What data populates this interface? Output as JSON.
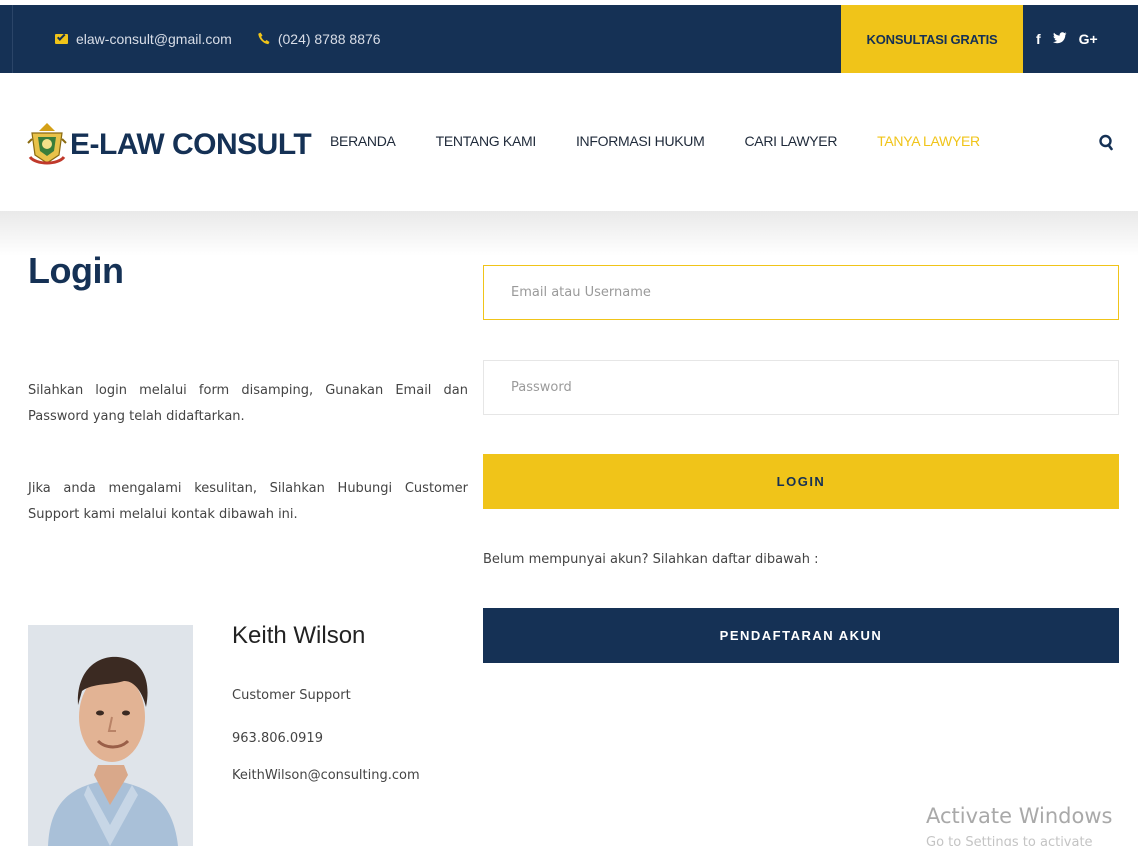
{
  "topbar": {
    "email": "elaw-consult@gmail.com",
    "phone": "(024) 8788 8876",
    "cta_label": "KONSULTASI GRATIS",
    "social": [
      "f",
      "y",
      "G+"
    ],
    "icons": [
      "mail-icon",
      "phone-icon",
      "facebook-icon",
      "twitter-icon",
      "google-plus-icon"
    ]
  },
  "header": {
    "logo_text": "E-LAW CONSULT",
    "nav": [
      {
        "label": "BERANDA",
        "active": false
      },
      {
        "label": "TENTANG KAMI",
        "active": false
      },
      {
        "label": "INFORMASI HUKUM",
        "active": false
      },
      {
        "label": "CARI LAWYER",
        "active": false
      },
      {
        "label": "TANYA LAWYER",
        "active": true
      }
    ],
    "search_icon": "search-icon"
  },
  "main": {
    "title": "Login",
    "paragraph_1": "Silahkan login melalui form disamping, Gunakan Email dan Password yang telah didaftarkan.",
    "paragraph_2": "Jika anda mengalami kesulitan, Silahkan Hubungi Customer Support kami melalui kontak dibawah ini.",
    "support": {
      "name": "Keith Wilson",
      "role": "Customer Support",
      "phone": "963.806.0919",
      "email": "KeithWilson@consulting.com"
    }
  },
  "form": {
    "email_placeholder": "Email atau Username",
    "email_value": "",
    "password_placeholder": "Password",
    "password_value": "",
    "login_label": "LOGIN",
    "no_account_text": "Belum mempunyai akun? Silahkan daftar dibawah :",
    "register_label": "PENDAFTARAN AKUN"
  },
  "overlay": {
    "watermark": "Activate Windows",
    "watermark_sub": "Go to Settings to activate Windows."
  },
  "colors": {
    "navy": "#153155",
    "gold": "#f0c419"
  }
}
